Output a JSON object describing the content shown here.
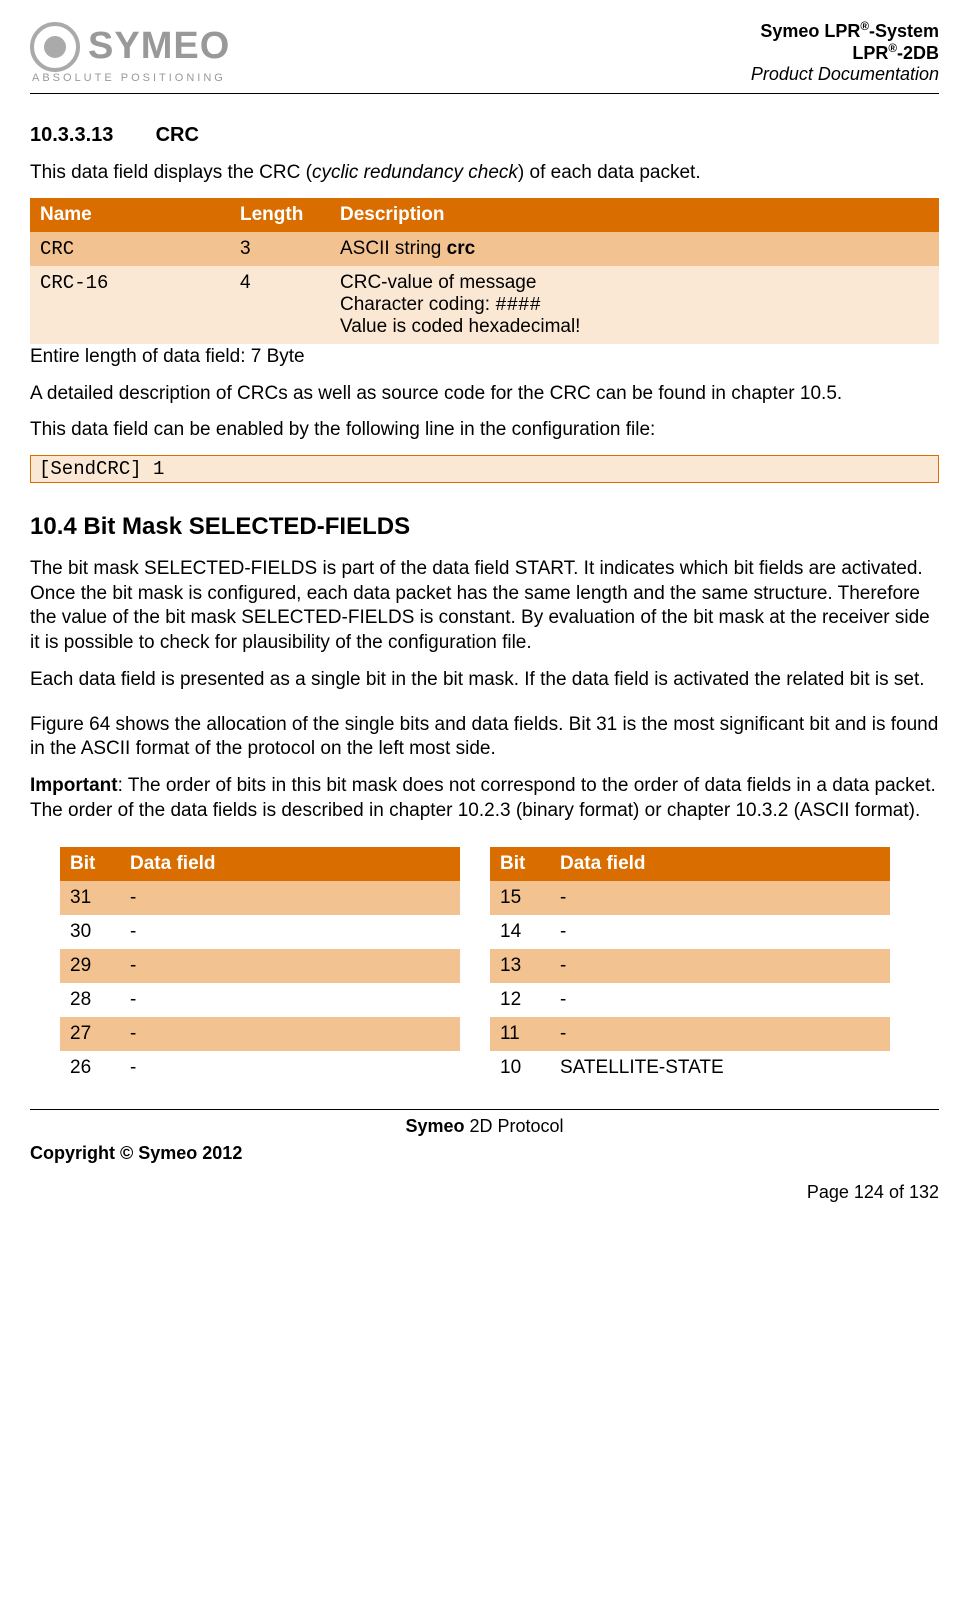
{
  "header": {
    "logo_text": "SYMEO",
    "logo_sub": "ABSOLUTE POSITIONING",
    "line1_a": "Symeo LPR",
    "line1_b": "-System",
    "line2_a": "LPR",
    "line2_b": "-2DB",
    "line3": "Product Documentation",
    "sup": "®"
  },
  "s1": {
    "num": "10.3.3.13",
    "title": "CRC",
    "intro_a": "This data field displays the CRC (",
    "intro_b": "cyclic redundancy check",
    "intro_c": ") of each data packet.",
    "th_name": "Name",
    "th_len": "Length",
    "th_desc": "Description",
    "r1_name": "CRC",
    "r1_len": "3",
    "r1_desc_a": "ASCII string ",
    "r1_desc_b": "crc",
    "r2_name": "CRC-16",
    "r2_len": "4",
    "r2_desc_l1": "CRC-value of message",
    "r2_desc_l2a": "Character coding:  ",
    "r2_desc_l2b": "####",
    "r2_desc_l3": "Value is coded hexadecimal!",
    "note": "Entire length of data field:  7 Byte",
    "p2": "A detailed description of CRCs as well as source code for the CRC can be found in chapter 10.5.",
    "p3": "This data field can be enabled by the following line in the configuration file:",
    "code": "[SendCRC]  1"
  },
  "s2": {
    "heading": "10.4  Bit Mask SELECTED-FIELDS",
    "p1": "The bit mask SELECTED-FIELDS is part of the data field START. It indicates which bit fields are activated. Once the bit mask is configured, each data packet has the same length and the same structure. Therefore the value of the bit mask SELECTED-FIELDS is constant. By evaluation of the bit mask at the receiver side it is possible to check for plausibility of the configuration file.",
    "p2": "Each data field is presented as a single bit in the bit mask. If the data field is activated the related bit is set.",
    "p3": "Figure 64 shows the allocation of the single bits and data fields. Bit 31 is the most significant bit and is found in the ASCII format of the protocol on the left most side.",
    "p4_a": "Important",
    "p4_b": ": The order of bits in this bit mask does not correspond to the order of data fields in a data packet. The order of the data fields is described in chapter 10.2.3 (binary format) or chapter 10.3.2 (ASCII format).",
    "th_bit": "Bit",
    "th_field": "Data field",
    "left": [
      {
        "bit": "31",
        "field": "-"
      },
      {
        "bit": "30",
        "field": "-"
      },
      {
        "bit": "29",
        "field": "-"
      },
      {
        "bit": "28",
        "field": "-"
      },
      {
        "bit": "27",
        "field": "-"
      },
      {
        "bit": "26",
        "field": "-"
      }
    ],
    "right": [
      {
        "bit": "15",
        "field": "-"
      },
      {
        "bit": "14",
        "field": "-"
      },
      {
        "bit": "13",
        "field": "-"
      },
      {
        "bit": "12",
        "field": "-"
      },
      {
        "bit": "11",
        "field": "-"
      },
      {
        "bit": "10",
        "field": "SATELLITE-STATE"
      }
    ]
  },
  "footer": {
    "center_a": "Symeo",
    "center_b": " 2D Protocol",
    "left": "Copyright © Symeo 2012",
    "right": "Page 124 of 132"
  }
}
